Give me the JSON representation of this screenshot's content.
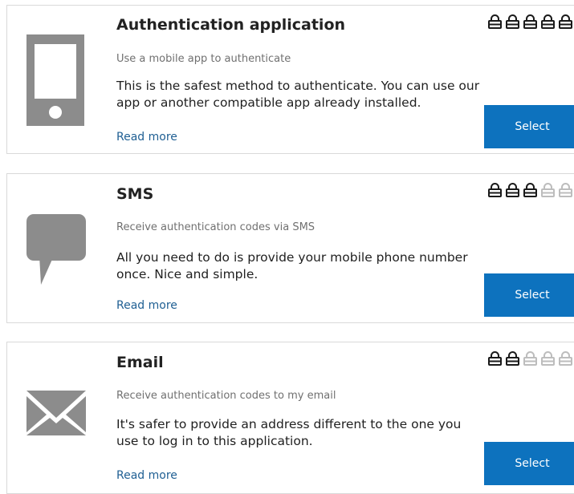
{
  "lock_colors": {
    "active": "#1a1a1a",
    "inactive": "#bdbdbd"
  },
  "accent_color": "#0d72be",
  "methods": [
    {
      "icon": "mobile-phone-icon",
      "title": "Authentication application",
      "subtitle": "Use a mobile app to authenticate",
      "description": "This is the safest method to authenticate. You can use our app or another compatible app already installed.",
      "read_more": "Read more",
      "select": "Select",
      "security_level": 5,
      "security_max": 5
    },
    {
      "icon": "speech-bubble-icon",
      "title": "SMS",
      "subtitle": "Receive authentication codes via SMS",
      "description": "All you need to do is provide your mobile phone number once. Nice and simple.",
      "read_more": "Read more",
      "select": "Select",
      "security_level": 3,
      "security_max": 5
    },
    {
      "icon": "envelope-icon",
      "title": "Email",
      "subtitle": "Receive authentication codes to my email",
      "description": "It's safer to provide an address different to the one you use to log in to this application.",
      "read_more": "Read more",
      "select": "Select",
      "security_level": 2,
      "security_max": 5
    }
  ]
}
